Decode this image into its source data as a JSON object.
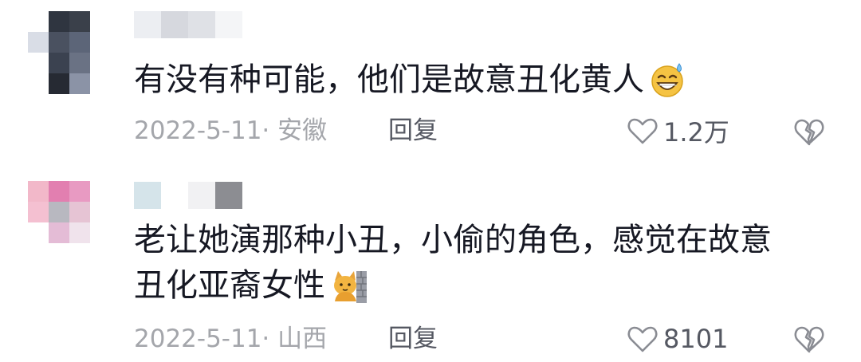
{
  "comments": [
    {
      "text_lines": [
        "有没有种可能，他们是故意丑化黄人"
      ],
      "emoji": "grinning-sweat-emoji",
      "date_location": "2022-5-11· 安徽",
      "reply_label": "回复",
      "like_count": "1.2万"
    },
    {
      "text_lines": [
        "老让她演那种小丑，小偷的角色，感觉在故意",
        "丑化亚裔女性"
      ],
      "emoji": "cat-peeking-behind-wall-emoji",
      "date_location": "2022-5-11· 山西",
      "reply_label": "回复",
      "like_count": "8101"
    }
  ],
  "colors": {
    "text": "#161823",
    "meta": "#a4a6ab",
    "action": "#555862"
  }
}
